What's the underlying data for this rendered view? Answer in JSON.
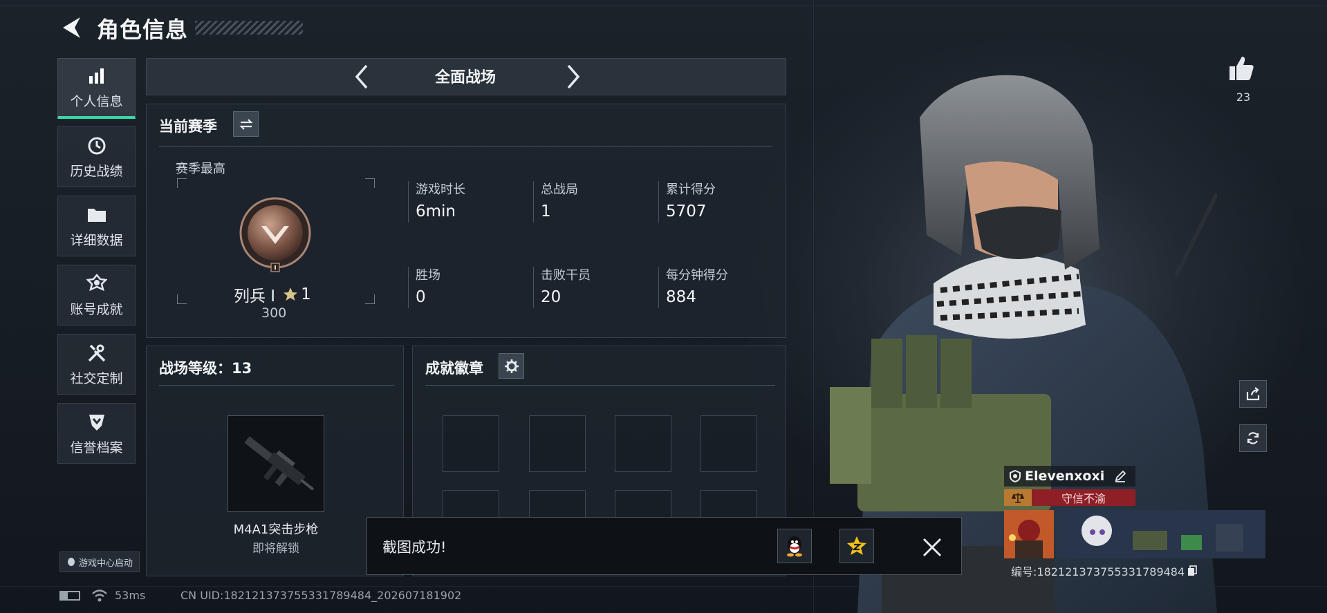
{
  "header": {
    "title": "角色信息"
  },
  "sidebar": {
    "items": [
      {
        "label": "个人信息",
        "icon": "bar-chart-icon",
        "active": true
      },
      {
        "label": "历史战绩",
        "icon": "clock-history-icon",
        "active": false
      },
      {
        "label": "详细数据",
        "icon": "folder-icon",
        "active": false
      },
      {
        "label": "账号成就",
        "icon": "medal-icon",
        "active": false
      },
      {
        "label": "社交定制",
        "icon": "tools-icon",
        "active": false
      },
      {
        "label": "信誉档案",
        "icon": "shield-chevron-icon",
        "active": false
      }
    ],
    "boot_tag": "游戏中心启动"
  },
  "mode": {
    "title": "全面战场"
  },
  "season": {
    "title": "当前赛季",
    "best_label": "赛季最高",
    "rank_name": "列兵 I",
    "rank_stars": "1",
    "rank_points": "300",
    "stats": [
      {
        "label": "游戏时长",
        "value": "6min"
      },
      {
        "label": "总战局",
        "value": "1"
      },
      {
        "label": "累计得分",
        "value": "5707"
      },
      {
        "label": "胜场",
        "value": "0"
      },
      {
        "label": "击败干员",
        "value": "20"
      },
      {
        "label": "每分钟得分",
        "value": "884"
      }
    ]
  },
  "battle_level": {
    "label": "战场等级：",
    "value": "13",
    "weapon_name": "M4A1突击步枪",
    "weapon_status": "即将解锁"
  },
  "achievements": {
    "title": "成就徽章"
  },
  "toast": {
    "message": "截图成功!"
  },
  "profile": {
    "likes": "23",
    "player_name": "Elevenxoxi",
    "reputation": "守信不渝",
    "id_text": "编号:182121373755331789484"
  },
  "status": {
    "ping": "53ms",
    "uid": "CN UID:182121373755331789484_202607181902"
  },
  "colors": {
    "accent": "#37d9a4",
    "reputation": "#a3232b"
  }
}
